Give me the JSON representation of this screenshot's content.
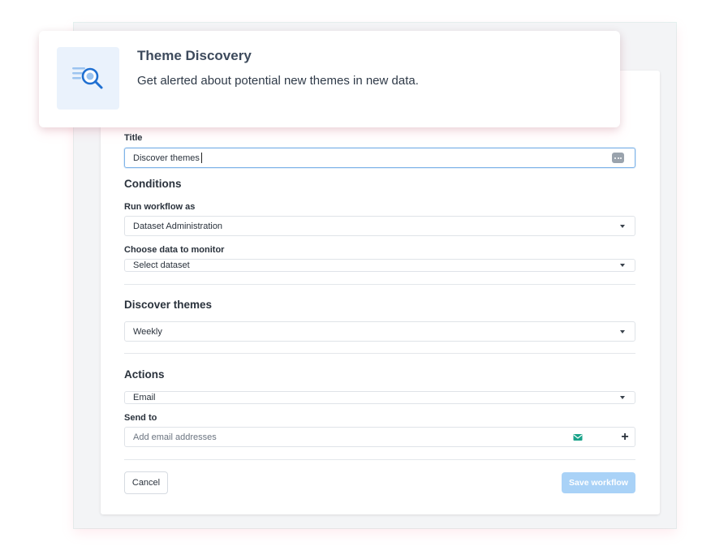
{
  "header": {
    "title": "Theme Discovery",
    "subtitle": "Get alerted about potential new themes in new data.",
    "icon": "search-magnify-icon"
  },
  "form": {
    "title_label": "Title",
    "title_value": "Discover themes",
    "conditions_heading": "Conditions",
    "run_as_label": "Run workflow as",
    "run_as_value": "Dataset Administration",
    "data_label": "Choose data to monitor",
    "data_value": "Select dataset",
    "discover_heading": "Discover themes",
    "frequency_value": "Weekly",
    "actions_heading": "Actions",
    "action_value": "Email",
    "send_to_label": "Send to",
    "send_to_placeholder": "Add email addresses",
    "plus_label": "+"
  },
  "buttons": {
    "cancel": "Cancel",
    "save": "Save workflow"
  },
  "colors": {
    "accent": "#1f6fd1",
    "save_disabled": "#a9d2f7",
    "focus_border": "#7fb3e8",
    "email_icon": "#1aa38a"
  }
}
